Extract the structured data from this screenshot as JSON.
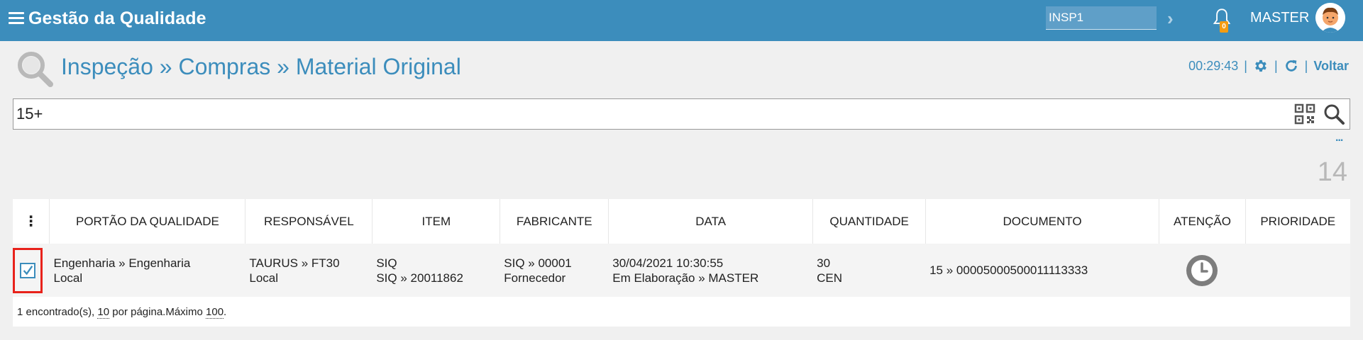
{
  "app": {
    "title": "Gestão da Qualidade"
  },
  "topbar": {
    "insp_value": "INSP1",
    "notifications": "0",
    "user": "MASTER"
  },
  "header": {
    "breadcrumb": "Inspeção » Compras » Material Original",
    "timer": "00:29:43",
    "sep": "|",
    "voltar": "Voltar"
  },
  "search": {
    "value": "15+"
  },
  "more_label": "...",
  "result_count": "14",
  "table": {
    "headers": [
      "PORTÃO DA QUALIDADE",
      "RESPONSÁVEL",
      "ITEM",
      "FABRICANTE",
      "DATA",
      "QUANTIDADE",
      "DOCUMENTO",
      "ATENÇÃO",
      "PRIORIDADE"
    ],
    "menu_glyph": "⋮",
    "row": {
      "checked": true,
      "portao": [
        "Engenharia » Engenharia",
        "Local"
      ],
      "responsavel": [
        "TAURUS » FT30",
        "Local"
      ],
      "item": [
        "SIQ",
        "SIQ » 20011862"
      ],
      "fabricante": [
        "SIQ » 00001",
        "Fornecedor"
      ],
      "data": [
        "30/04/2021 10:30:55",
        "Em Elaboração » MASTER"
      ],
      "quantidade": [
        "30",
        "CEN"
      ],
      "documento": "15 » 00005000500011113333",
      "atencao_icon": "clock-icon",
      "prioridade": ""
    }
  },
  "footer": {
    "found": "1 encontrado(s),",
    "per_page_value": "10",
    "per_page_label": "por página.Máximo",
    "max_value": "100",
    "end": "."
  },
  "colors": {
    "topbar": "#3c8dbc",
    "accent": "#3c8dbc",
    "highlight_border": "#e8221b",
    "badge": "#f39c12"
  }
}
